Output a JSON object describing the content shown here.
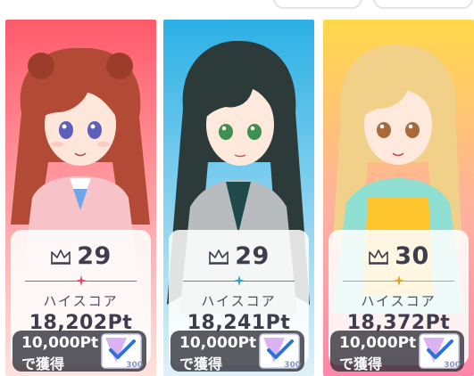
{
  "cards": [
    {
      "rank": "29",
      "highscore_label": "ハイスコア",
      "score": "18,202Pt",
      "reward_points": "10,000Pt",
      "reward_action": "で獲得",
      "ticket_count": "300",
      "accent_color": "#e8465f",
      "background_top": "#ff5a6b",
      "background_bottom": "#ffe2dc",
      "hair_color": "#b24a36"
    },
    {
      "rank": "29",
      "highscore_label": "ハイスコア",
      "score": "18,241Pt",
      "reward_points": "10,000Pt",
      "reward_action": "で獲得",
      "ticket_count": "300",
      "accent_color": "#2c9ed6",
      "background_top": "#2bb0e6",
      "background_bottom": "#dff1f8",
      "hair_color": "#2c3a3a"
    },
    {
      "rank": "30",
      "highscore_label": "ハイスコア",
      "score": "18,372Pt",
      "reward_points": "10,000Pt",
      "reward_action": "で獲得",
      "ticket_count": "300",
      "accent_color": "#e0a31c",
      "background_top": "#ffd84a",
      "background_bottom": "#ff86a8",
      "hair_color": "#f1d08a"
    }
  ]
}
